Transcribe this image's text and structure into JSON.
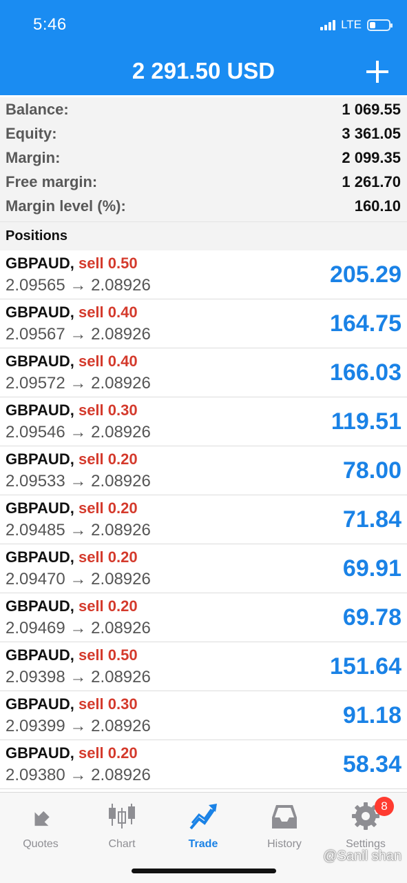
{
  "status_bar": {
    "time": "5:46",
    "network": "LTE"
  },
  "header": {
    "title": "2 291.50 USD"
  },
  "summary": [
    {
      "label": "Balance:",
      "value": "1 069.55"
    },
    {
      "label": "Equity:",
      "value": "3 361.05"
    },
    {
      "label": "Margin:",
      "value": "2 099.35"
    },
    {
      "label": "Free margin:",
      "value": "1 261.70"
    },
    {
      "label": "Margin level (%):",
      "value": "160.10"
    }
  ],
  "positions_header": "Positions",
  "positions": [
    {
      "symbol": "GBPAUD,",
      "type": "sell 0.50",
      "prices": "2.09565 → 2.08926",
      "profit": "205.29"
    },
    {
      "symbol": "GBPAUD,",
      "type": "sell 0.40",
      "prices": "2.09567 → 2.08926",
      "profit": "164.75"
    },
    {
      "symbol": "GBPAUD,",
      "type": "sell 0.40",
      "prices": "2.09572 → 2.08926",
      "profit": "166.03"
    },
    {
      "symbol": "GBPAUD,",
      "type": "sell 0.30",
      "prices": "2.09546 → 2.08926",
      "profit": "119.51"
    },
    {
      "symbol": "GBPAUD,",
      "type": "sell 0.20",
      "prices": "2.09533 → 2.08926",
      "profit": "78.00"
    },
    {
      "symbol": "GBPAUD,",
      "type": "sell 0.20",
      "prices": "2.09485 → 2.08926",
      "profit": "71.84"
    },
    {
      "symbol": "GBPAUD,",
      "type": "sell 0.20",
      "prices": "2.09470 → 2.08926",
      "profit": "69.91"
    },
    {
      "symbol": "GBPAUD,",
      "type": "sell 0.20",
      "prices": "2.09469 → 2.08926",
      "profit": "69.78"
    },
    {
      "symbol": "GBPAUD,",
      "type": "sell 0.50",
      "prices": "2.09398 → 2.08926",
      "profit": "151.64"
    },
    {
      "symbol": "GBPAUD,",
      "type": "sell 0.30",
      "prices": "2.09399 → 2.08926",
      "profit": "91.18"
    },
    {
      "symbol": "GBPAUD,",
      "type": "sell 0.20",
      "prices": "2.09380 → 2.08926",
      "profit": "58.34"
    }
  ],
  "tabbar": {
    "quotes": "Quotes",
    "chart": "Chart",
    "trade": "Trade",
    "history": "History",
    "settings": "Settings",
    "settings_badge": "8"
  },
  "watermark": "@Sanil shan",
  "colors": {
    "accent": "#1a8cf2",
    "sell": "#d43a2c",
    "profit": "#1a82e6"
  }
}
